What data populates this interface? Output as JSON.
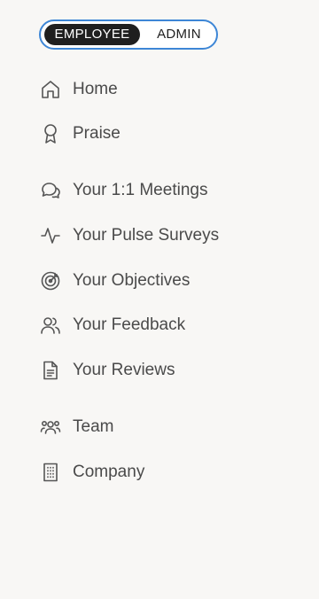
{
  "mode_toggle": {
    "active": "EMPLOYEE",
    "inactive": "ADMIN"
  },
  "nav": {
    "items": [
      {
        "label": "Home",
        "icon": "home-icon"
      },
      {
        "label": "Praise",
        "icon": "award-ribbon-icon"
      },
      {
        "label": "Your 1:1 Meetings",
        "icon": "chat-bubbles-icon"
      },
      {
        "label": "Your Pulse Surveys",
        "icon": "pulse-icon"
      },
      {
        "label": "Your Objectives",
        "icon": "target-icon"
      },
      {
        "label": "Your Feedback",
        "icon": "users-icon"
      },
      {
        "label": "Your Reviews",
        "icon": "document-icon"
      },
      {
        "label": "Team",
        "icon": "team-icon"
      },
      {
        "label": "Company",
        "icon": "building-icon"
      }
    ]
  },
  "colors": {
    "background": "#f8f7f5",
    "toggle_border": "#3d86d6",
    "toggle_active_bg": "#1f1f1f",
    "text": "#4a4a4a"
  }
}
